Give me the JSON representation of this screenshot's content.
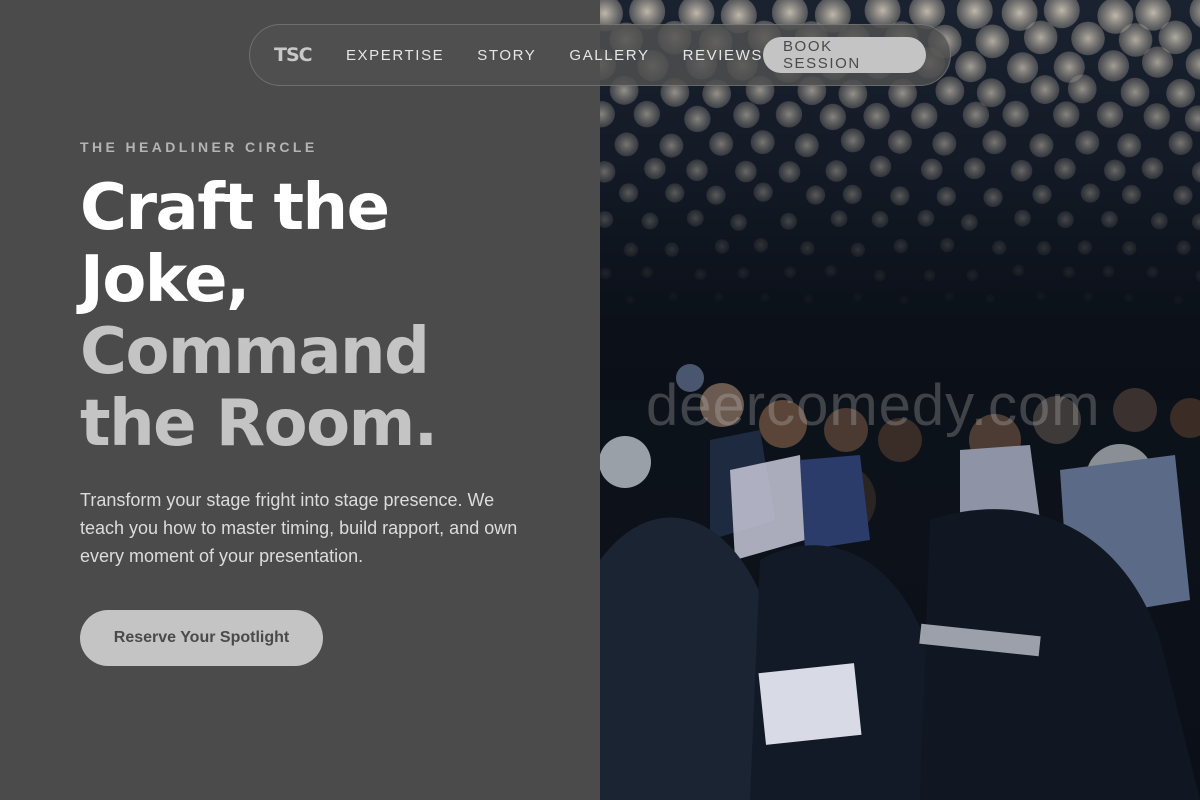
{
  "nav": {
    "logo": "TSC",
    "links": [
      "EXPERTISE",
      "STORY",
      "GALLERY",
      "REVIEWS"
    ],
    "book_label": "BOOK SESSION"
  },
  "hero": {
    "eyebrow": "THE HEADLINER CIRCLE",
    "headline_white_1": "Craft the",
    "headline_white_2": "Joke,",
    "headline_gray_1": "Command",
    "headline_gray_2": "the Room.",
    "lead": "Transform your stage fright into stage presence. We teach you how to master timing, build rapport, and own every moment of your presentation.",
    "cta_label": "Reserve Your Spotlight"
  },
  "photo": {
    "watermark": "deercomedy.com"
  },
  "colors": {
    "left_bg": "#4b4b4b",
    "accent_gray": "#c4c4c4",
    "text_white": "#ffffff"
  }
}
